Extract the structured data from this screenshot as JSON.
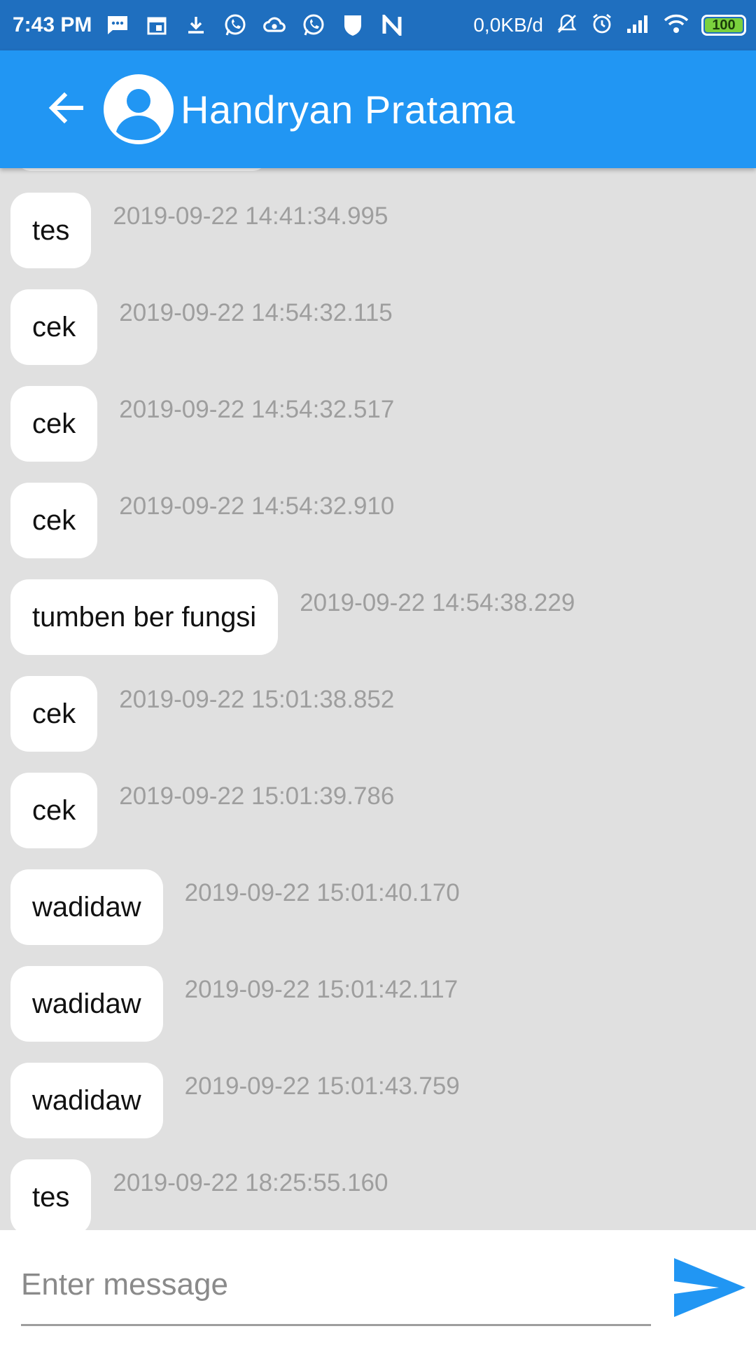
{
  "status_bar": {
    "time": "7:43 PM",
    "network_speed": "0,0KB/d",
    "battery_level": "100",
    "icons": [
      "message-icon",
      "calendar-icon",
      "download-icon",
      "whatsapp-icon",
      "cloud-icon",
      "whatsapp-icon",
      "shield-icon",
      "n-icon",
      "mute-icon",
      "alarm-icon",
      "signal-icon",
      "wifi-icon",
      "battery-icon"
    ]
  },
  "app_bar": {
    "contact_name": "Handryan Pratama",
    "color": "#2196f3"
  },
  "messages": [
    {
      "text": "tes",
      "timestamp": "2019-09-22 14:41:34.995"
    },
    {
      "text": "cek",
      "timestamp": "2019-09-22 14:54:32.115"
    },
    {
      "text": "cek",
      "timestamp": "2019-09-22 14:54:32.517"
    },
    {
      "text": "cek",
      "timestamp": "2019-09-22 14:54:32.910"
    },
    {
      "text": "tumben ber fungsi",
      "timestamp": "2019-09-22 14:54:38.229"
    },
    {
      "text": "cek",
      "timestamp": "2019-09-22 15:01:38.852"
    },
    {
      "text": "cek",
      "timestamp": "2019-09-22 15:01:39.786"
    },
    {
      "text": "wadidaw",
      "timestamp": "2019-09-22 15:01:40.170"
    },
    {
      "text": "wadidaw",
      "timestamp": "2019-09-22 15:01:42.117"
    },
    {
      "text": "wadidaw",
      "timestamp": "2019-09-22 15:01:43.759"
    },
    {
      "text": "tes",
      "timestamp": "2019-09-22 18:25:55.160"
    }
  ],
  "composer": {
    "placeholder": "Enter message",
    "value": ""
  }
}
